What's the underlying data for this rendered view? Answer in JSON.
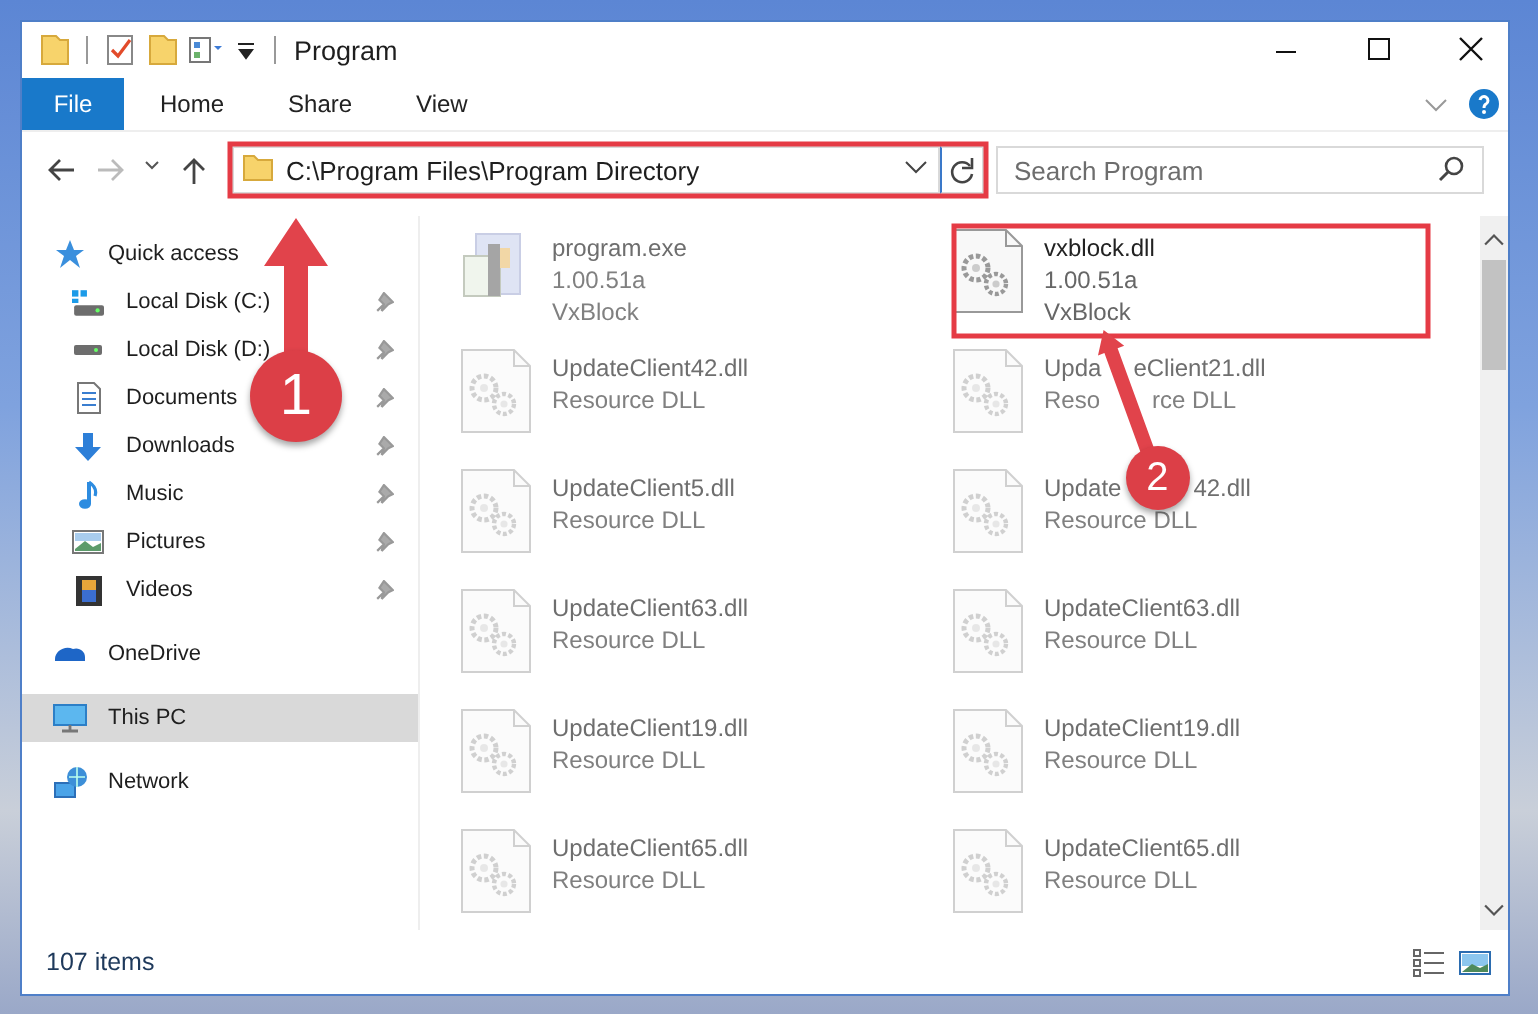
{
  "window": {
    "title": "Program"
  },
  "ribbon": {
    "tabs": [
      {
        "label": "File",
        "kind": "file",
        "selected": false
      },
      {
        "label": "Home",
        "kind": "tab",
        "selected": false
      },
      {
        "label": "Share",
        "kind": "tab",
        "selected": false
      },
      {
        "label": "View",
        "kind": "tab",
        "selected": false
      }
    ]
  },
  "address": {
    "path": "C:\\Program Files\\Program Directory"
  },
  "search": {
    "placeholder": "Search Program"
  },
  "sidebar": {
    "items": [
      {
        "label": "Quick access",
        "selected": false,
        "children": [
          {
            "label": "Local Disk (C:)",
            "pinned": true,
            "selected": false
          },
          {
            "label": "Local Disk (D:)",
            "pinned": true,
            "selected": false
          },
          {
            "label": "Documents",
            "pinned": true,
            "selected": false
          },
          {
            "label": "Downloads",
            "pinned": true,
            "selected": false
          },
          {
            "label": "Music",
            "pinned": true,
            "selected": false
          },
          {
            "label": "Pictures",
            "pinned": true,
            "selected": false
          },
          {
            "label": "Videos",
            "pinned": true,
            "selected": false
          }
        ]
      },
      {
        "label": "OneDrive",
        "selected": false
      },
      {
        "label": "This PC",
        "selected": true
      },
      {
        "label": "Network",
        "selected": false
      }
    ]
  },
  "files": {
    "items": [
      {
        "kind": "exe",
        "name": "program.exe",
        "line_2": "1.00.51a",
        "line_3": "VxBlock",
        "faded": true
      },
      {
        "kind": "dll",
        "name": "vxblock.dll",
        "line_2": "1.00.51a",
        "line_3": "VxBlock",
        "faded": false
      },
      {
        "kind": "dll",
        "name": "UpdateClient42.dll",
        "line_2": "Resource DLL",
        "faded": true
      },
      {
        "kind": "dll",
        "name": "Upda",
        "name_end": "eClient21.dll",
        "line_2": "Reso",
        "line_2_end": "rce DLL",
        "faded": true
      },
      {
        "kind": "dll",
        "name": "UpdateClient5.dll",
        "line_2": "Resource DLL",
        "faded": true
      },
      {
        "kind": "dll",
        "name": "Update",
        "name_end": "42.dll",
        "line_2": "Resource DLL",
        "faded": true
      },
      {
        "kind": "dll",
        "name": "UpdateClient63.dll",
        "line_2": "Resource DLL",
        "faded": true
      },
      {
        "kind": "dll",
        "name": "UpdateClient63.dll",
        "line_2": "Resource DLL",
        "faded": true
      },
      {
        "kind": "dll",
        "name": "UpdateClient19.dll",
        "line_2": "Resource DLL",
        "faded": true
      },
      {
        "kind": "dll",
        "name": "UpdateClient19.dll",
        "line_2": "Resource DLL",
        "faded": true
      },
      {
        "kind": "dll",
        "name": "UpdateClient65.dll",
        "line_2": "Resource DLL",
        "faded": true
      },
      {
        "kind": "dll",
        "name": "UpdateClient65.dll",
        "line_2": "Resource DLL",
        "faded": true
      }
    ]
  },
  "status_bar": {
    "count": "107 items"
  },
  "annotations": [
    {
      "number": "1"
    },
    {
      "number": "2"
    }
  ]
}
